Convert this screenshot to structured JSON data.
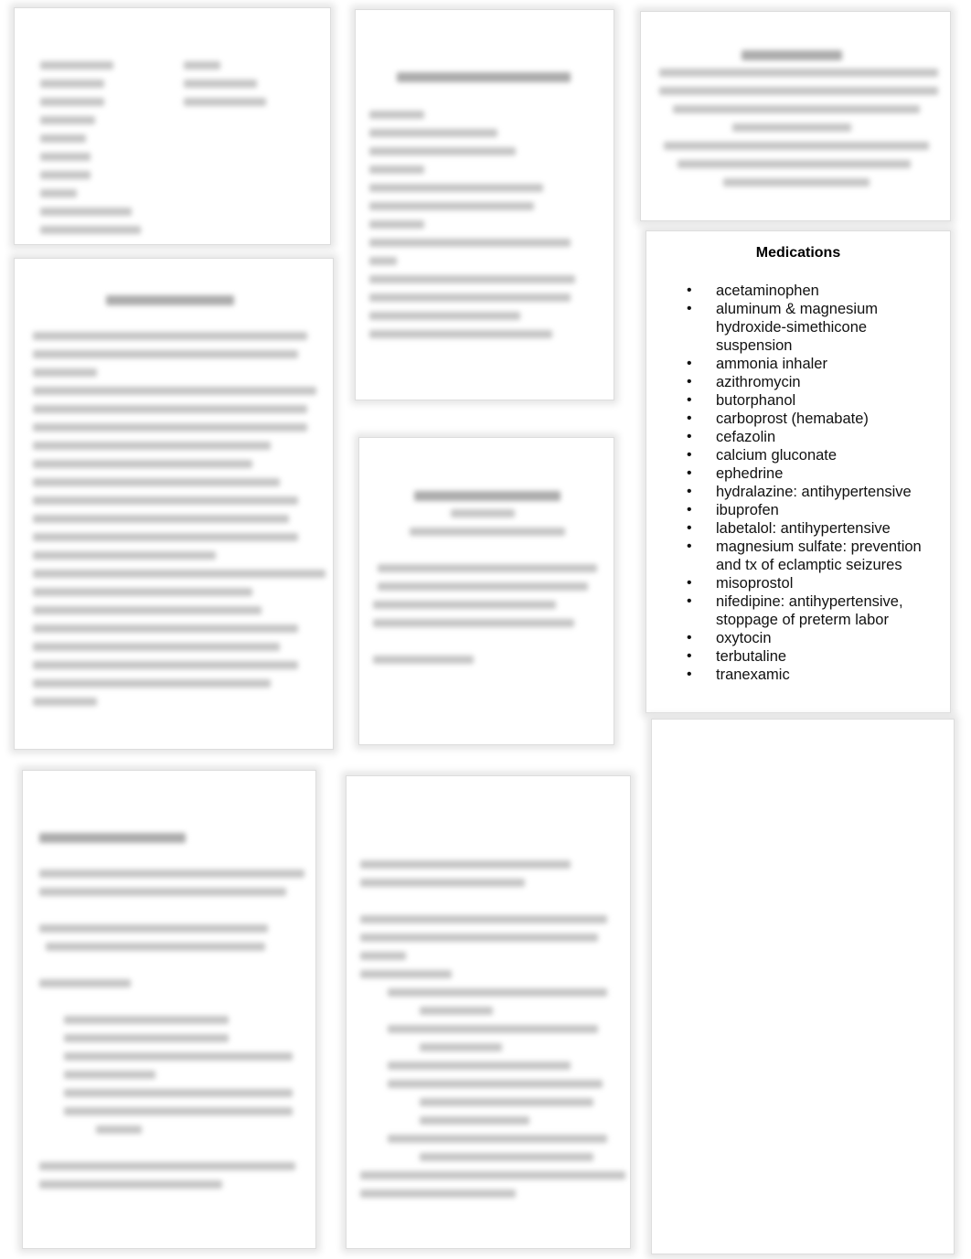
{
  "medications": {
    "title": "Medications",
    "items": [
      "acetaminophen",
      "aluminum & magnesium hydroxide-simethicone suspension",
      "ammonia inhaler",
      "azithromycin",
      "butorphanol",
      "carboprost (hemabate)",
      "cefazolin",
      "calcium gluconate",
      "ephedrine",
      "hydralazine: antihypertensive",
      "ibuprofen",
      "labetalol: antihypertensive",
      "magnesium sulfate: prevention and tx of eclamptic seizures",
      "misoprostol",
      "nifedipine: antihypertensive, stoppage of preterm labor",
      "oxytocin",
      "terbutaline",
      "tranexamic"
    ],
    "bullet": "•"
  },
  "colors": {
    "border": "#dddddd",
    "text": "#111111",
    "blurred_text": "#c4c4c4"
  }
}
